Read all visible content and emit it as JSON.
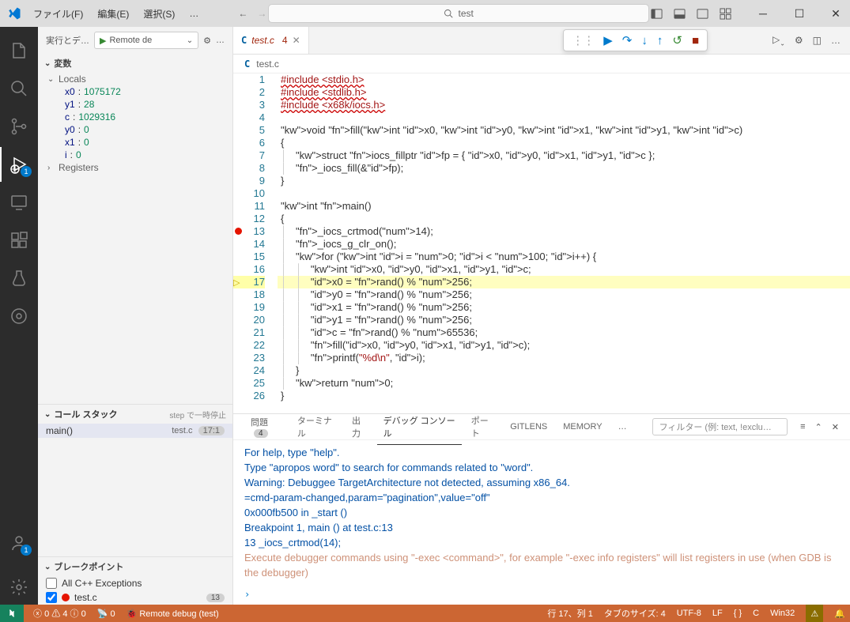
{
  "menu": {
    "file": "ファイル(F)",
    "edit": "編集(E)",
    "select": "選択(S)",
    "more": "…"
  },
  "search": {
    "text": "test"
  },
  "sidebar": {
    "header_title": "実行とデ…",
    "run_config": "Remote de",
    "variables_title": "変数",
    "locals_label": "Locals",
    "registers_label": "Registers",
    "vars": [
      {
        "name": "x0",
        "value": "1075172"
      },
      {
        "name": "y1",
        "value": "28"
      },
      {
        "name": "c",
        "value": "1029316"
      },
      {
        "name": "y0",
        "value": "0"
      },
      {
        "name": "x1",
        "value": "0"
      },
      {
        "name": "i",
        "value": "0"
      }
    ],
    "callstack_title": "コール スタック",
    "callstack_meta": "step で一時停止",
    "callstack": [
      {
        "fn": "main()",
        "file": "test.c",
        "loc": "17:1"
      }
    ],
    "breakpoints_title": "ブレークポイント",
    "bp_all_label": "All C++ Exceptions",
    "bp_items": [
      {
        "file": "test.c",
        "line": "13",
        "checked": true
      }
    ]
  },
  "tab": {
    "name": "test.c",
    "problems": "4"
  },
  "breadcrumb": {
    "file": "test.c"
  },
  "code": {
    "lines": [
      "#include <stdio.h>",
      "#include <stdlib.h>",
      "#include <x68k/iocs.h>",
      "",
      "void fill(int x0, int y0, int x1, int y1, int c)",
      "{",
      "    struct iocs_fillptr fp = { x0, y0, x1, y1, c };",
      "    _iocs_fill(&fp);",
      "}",
      "",
      "int main()",
      "{",
      "    _iocs_crtmod(14);",
      "    _iocs_g_clr_on();",
      "    for (int i = 0; i < 100; i++) {",
      "        int x0, y0, x1, y1, c;",
      "        x0 = rand() % 256;",
      "        y0 = rand() % 256;",
      "        x1 = rand() % 256;",
      "        y1 = rand() % 256;",
      "        c = rand() % 65536;",
      "        fill(x0, y0, x1, y1, c);",
      "        printf(\"%d\\n\", i);",
      "    }",
      "    return 0;",
      "}"
    ],
    "breakpoint_line": 13,
    "current_line": 17
  },
  "panel": {
    "tabs": {
      "problems": "問題",
      "problems_count": "4",
      "terminal": "ターミナル",
      "output": "出力",
      "debug": "デバッグ コンソール",
      "ports": "ポート",
      "gitlens": "GITLENS",
      "memory": "MEMORY"
    },
    "filter_placeholder": "フィルター (例: text, !exclu…",
    "lines": [
      "For help, type \"help\".",
      "Type \"apropos word\" to search for commands related to \"word\".",
      "Warning: Debuggee TargetArchitecture not detected, assuming x86_64.",
      "=cmd-param-changed,param=\"pagination\",value=\"off\"",
      "0x000fb500 in _start ()",
      "",
      "Breakpoint 1, main () at test.c:13",
      "13              _iocs_crtmod(14);",
      "Execute debugger commands using \"-exec <command>\", for example \"-exec info registers\" will list registers in use (when GDB is the debugger)"
    ]
  },
  "status": {
    "errors": "0",
    "warnings": "4",
    "info": "0",
    "radio": "0",
    "remote": "Remote debug (test)",
    "cursor": "行 17、列 1",
    "tabsize": "タブのサイズ: 4",
    "encoding": "UTF-8",
    "eol": "LF",
    "lang_brace": "{ }",
    "lang": "C",
    "platform": "Win32"
  },
  "activity_badge": "1"
}
